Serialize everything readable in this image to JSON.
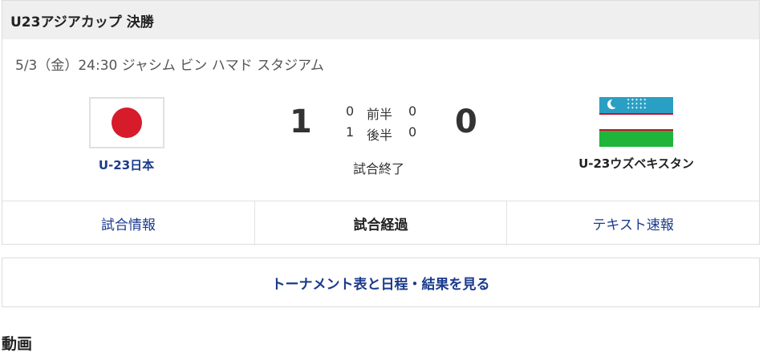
{
  "header": {
    "title": "U23アジアカップ 決勝"
  },
  "match": {
    "info": "5/3（金）24:30 ジャシム ビン ハマド スタジアム",
    "home": {
      "name": "U-23日本",
      "score": "1",
      "flag_icon": "japan-flag-icon"
    },
    "away": {
      "name": "U-23ウズベキスタン",
      "score": "0",
      "flag_icon": "uzbekistan-flag-icon"
    },
    "halves": [
      {
        "home": "0",
        "label": "前半",
        "away": "0"
      },
      {
        "home": "1",
        "label": "後半",
        "away": "0"
      }
    ],
    "status": "試合終了"
  },
  "tabs": [
    {
      "label": "試合情報",
      "active": false
    },
    {
      "label": "試合経過",
      "active": true
    },
    {
      "label": "テキスト速報",
      "active": false
    }
  ],
  "tournament_link": "トーナメント表と日程・結果を見る",
  "video_section": {
    "title": "動画"
  },
  "colors": {
    "link": "#1a3a8c",
    "header_bg": "#efefef",
    "border": "#dcdcdc"
  }
}
